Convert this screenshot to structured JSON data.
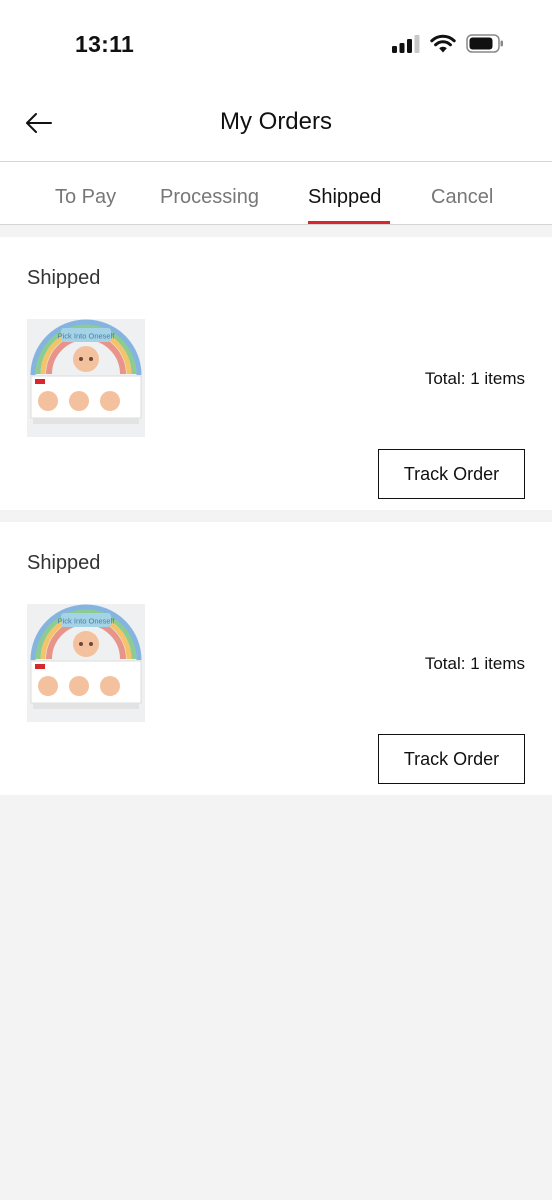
{
  "status_bar": {
    "time": "13:11"
  },
  "header": {
    "title": "My Orders"
  },
  "tabs": [
    {
      "label": "To Pay",
      "active": false
    },
    {
      "label": "Processing",
      "active": false
    },
    {
      "label": "Shipped",
      "active": true
    },
    {
      "label": "Cancel",
      "active": false
    }
  ],
  "orders": [
    {
      "status": "Shipped",
      "total": "Total: 1 items",
      "action": "Track Order",
      "image_text": "Pick Into Oneself"
    },
    {
      "status": "Shipped",
      "total": "Total: 1 items",
      "action": "Track Order",
      "image_text": "Pick Into Oneself"
    }
  ],
  "colors": {
    "accent": "#d8262d",
    "background": "#f3f3f3"
  }
}
